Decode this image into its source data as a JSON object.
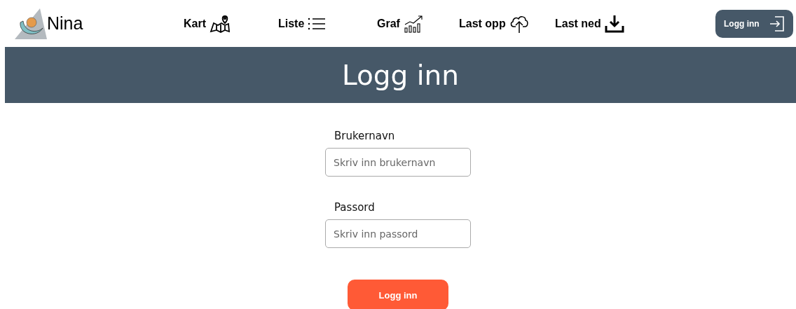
{
  "logo": {
    "text": "Nina"
  },
  "nav": [
    {
      "label": "Kart",
      "kind": "map"
    },
    {
      "label": "Liste",
      "kind": "list"
    },
    {
      "label": "Graf",
      "kind": "chart"
    },
    {
      "label": "Last opp",
      "kind": "upload"
    },
    {
      "label": "Last ned",
      "kind": "download"
    }
  ],
  "login_button": {
    "label": "Logg inn"
  },
  "banner": {
    "title": "Logg inn"
  },
  "form": {
    "fields": [
      {
        "label": "Brukernavn",
        "placeholder": "Skriv inn brukernavn"
      },
      {
        "label": "Passord",
        "placeholder": "Skriv inn passord"
      }
    ],
    "submit": "Logg inn"
  }
}
